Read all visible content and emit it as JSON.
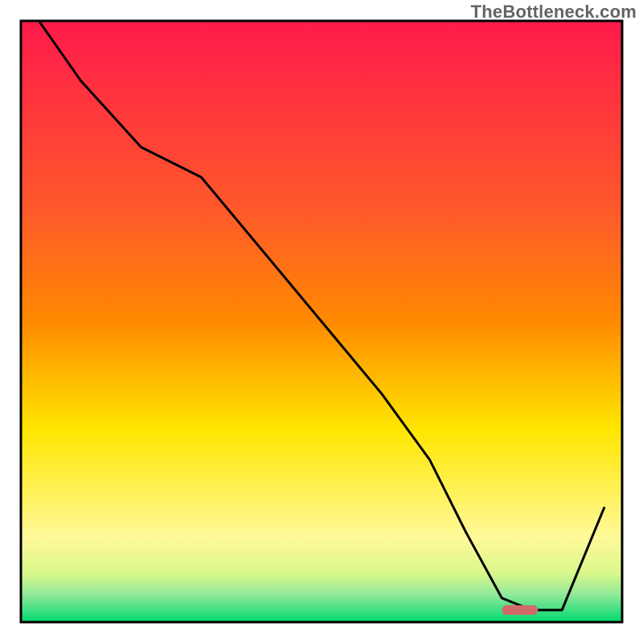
{
  "watermark": "TheBottleneck.com",
  "chart_data": {
    "type": "line",
    "title": "",
    "xlabel": "",
    "ylabel": "",
    "xlim": [
      0,
      100
    ],
    "ylim": [
      0,
      100
    ],
    "x": [
      3,
      10,
      20,
      30,
      40,
      50,
      60,
      68,
      74,
      80,
      85,
      90,
      97
    ],
    "values": [
      100,
      90,
      79,
      74,
      62,
      50,
      38,
      27,
      15,
      4,
      2,
      2,
      19
    ],
    "marker": {
      "x_start": 80,
      "x_end": 86,
      "y": 2,
      "color": "#d16a6a"
    },
    "colors": {
      "gradient_top": "#ff1a4b",
      "gradient_mid1": "#ff8a00",
      "gradient_mid2": "#ffe600",
      "gradient_mid3": "#fff99a",
      "gradient_bottom": "#00d96f",
      "line": "#000000",
      "border": "#000000"
    }
  }
}
